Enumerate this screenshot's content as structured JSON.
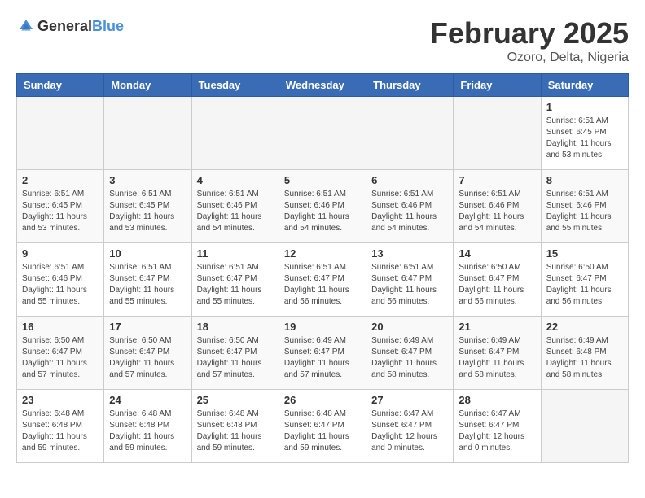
{
  "header": {
    "logo_general": "General",
    "logo_blue": "Blue",
    "title": "February 2025",
    "location": "Ozoro, Delta, Nigeria"
  },
  "weekdays": [
    "Sunday",
    "Monday",
    "Tuesday",
    "Wednesday",
    "Thursday",
    "Friday",
    "Saturday"
  ],
  "weeks": [
    [
      {
        "day": "",
        "info": ""
      },
      {
        "day": "",
        "info": ""
      },
      {
        "day": "",
        "info": ""
      },
      {
        "day": "",
        "info": ""
      },
      {
        "day": "",
        "info": ""
      },
      {
        "day": "",
        "info": ""
      },
      {
        "day": "1",
        "info": "Sunrise: 6:51 AM\nSunset: 6:45 PM\nDaylight: 11 hours and 53 minutes."
      }
    ],
    [
      {
        "day": "2",
        "info": "Sunrise: 6:51 AM\nSunset: 6:45 PM\nDaylight: 11 hours and 53 minutes."
      },
      {
        "day": "3",
        "info": "Sunrise: 6:51 AM\nSunset: 6:45 PM\nDaylight: 11 hours and 53 minutes."
      },
      {
        "day": "4",
        "info": "Sunrise: 6:51 AM\nSunset: 6:46 PM\nDaylight: 11 hours and 54 minutes."
      },
      {
        "day": "5",
        "info": "Sunrise: 6:51 AM\nSunset: 6:46 PM\nDaylight: 11 hours and 54 minutes."
      },
      {
        "day": "6",
        "info": "Sunrise: 6:51 AM\nSunset: 6:46 PM\nDaylight: 11 hours and 54 minutes."
      },
      {
        "day": "7",
        "info": "Sunrise: 6:51 AM\nSunset: 6:46 PM\nDaylight: 11 hours and 54 minutes."
      },
      {
        "day": "8",
        "info": "Sunrise: 6:51 AM\nSunset: 6:46 PM\nDaylight: 11 hours and 55 minutes."
      }
    ],
    [
      {
        "day": "9",
        "info": "Sunrise: 6:51 AM\nSunset: 6:46 PM\nDaylight: 11 hours and 55 minutes."
      },
      {
        "day": "10",
        "info": "Sunrise: 6:51 AM\nSunset: 6:47 PM\nDaylight: 11 hours and 55 minutes."
      },
      {
        "day": "11",
        "info": "Sunrise: 6:51 AM\nSunset: 6:47 PM\nDaylight: 11 hours and 55 minutes."
      },
      {
        "day": "12",
        "info": "Sunrise: 6:51 AM\nSunset: 6:47 PM\nDaylight: 11 hours and 56 minutes."
      },
      {
        "day": "13",
        "info": "Sunrise: 6:51 AM\nSunset: 6:47 PM\nDaylight: 11 hours and 56 minutes."
      },
      {
        "day": "14",
        "info": "Sunrise: 6:50 AM\nSunset: 6:47 PM\nDaylight: 11 hours and 56 minutes."
      },
      {
        "day": "15",
        "info": "Sunrise: 6:50 AM\nSunset: 6:47 PM\nDaylight: 11 hours and 56 minutes."
      }
    ],
    [
      {
        "day": "16",
        "info": "Sunrise: 6:50 AM\nSunset: 6:47 PM\nDaylight: 11 hours and 57 minutes."
      },
      {
        "day": "17",
        "info": "Sunrise: 6:50 AM\nSunset: 6:47 PM\nDaylight: 11 hours and 57 minutes."
      },
      {
        "day": "18",
        "info": "Sunrise: 6:50 AM\nSunset: 6:47 PM\nDaylight: 11 hours and 57 minutes."
      },
      {
        "day": "19",
        "info": "Sunrise: 6:49 AM\nSunset: 6:47 PM\nDaylight: 11 hours and 57 minutes."
      },
      {
        "day": "20",
        "info": "Sunrise: 6:49 AM\nSunset: 6:47 PM\nDaylight: 11 hours and 58 minutes."
      },
      {
        "day": "21",
        "info": "Sunrise: 6:49 AM\nSunset: 6:47 PM\nDaylight: 11 hours and 58 minutes."
      },
      {
        "day": "22",
        "info": "Sunrise: 6:49 AM\nSunset: 6:48 PM\nDaylight: 11 hours and 58 minutes."
      }
    ],
    [
      {
        "day": "23",
        "info": "Sunrise: 6:48 AM\nSunset: 6:48 PM\nDaylight: 11 hours and 59 minutes."
      },
      {
        "day": "24",
        "info": "Sunrise: 6:48 AM\nSunset: 6:48 PM\nDaylight: 11 hours and 59 minutes."
      },
      {
        "day": "25",
        "info": "Sunrise: 6:48 AM\nSunset: 6:48 PM\nDaylight: 11 hours and 59 minutes."
      },
      {
        "day": "26",
        "info": "Sunrise: 6:48 AM\nSunset: 6:47 PM\nDaylight: 11 hours and 59 minutes."
      },
      {
        "day": "27",
        "info": "Sunrise: 6:47 AM\nSunset: 6:47 PM\nDaylight: 12 hours and 0 minutes."
      },
      {
        "day": "28",
        "info": "Sunrise: 6:47 AM\nSunset: 6:47 PM\nDaylight: 12 hours and 0 minutes."
      },
      {
        "day": "",
        "info": ""
      }
    ]
  ]
}
